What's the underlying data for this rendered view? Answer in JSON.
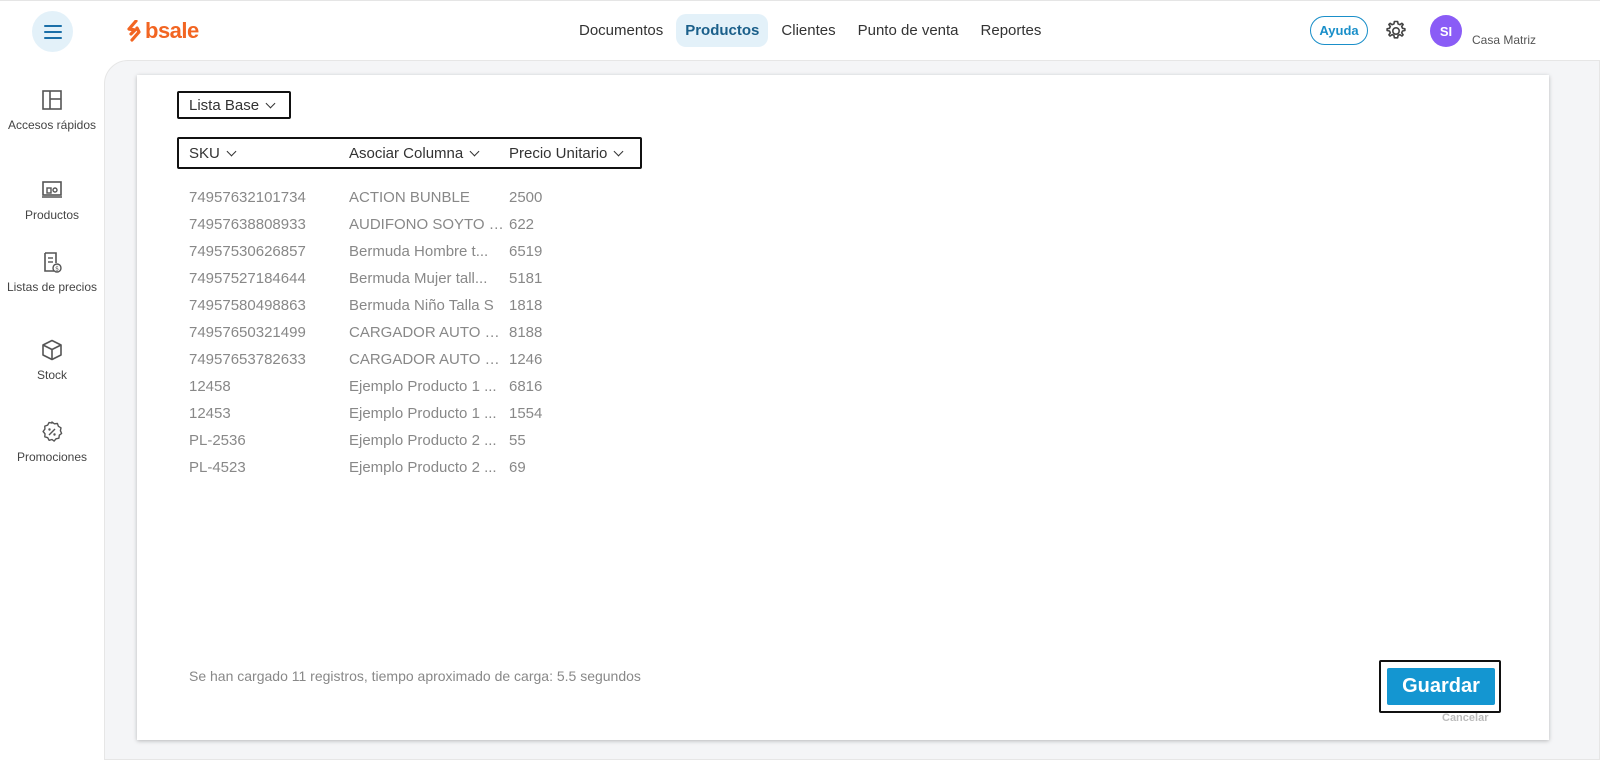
{
  "logo": {
    "text": "bsale"
  },
  "nav": {
    "items": [
      {
        "label": "Documentos",
        "active": false
      },
      {
        "label": "Productos",
        "active": true
      },
      {
        "label": "Clientes",
        "active": false
      },
      {
        "label": "Punto de venta",
        "active": false
      },
      {
        "label": "Reportes",
        "active": false
      }
    ]
  },
  "header": {
    "help_label": "Ayuda",
    "avatar_initials": "SI",
    "branch": "Casa Matriz"
  },
  "sidebar": {
    "items": [
      {
        "label": "Accesos rápidos",
        "icon": "layout-icon"
      },
      {
        "label": "Productos",
        "icon": "products-icon"
      },
      {
        "label": "Listas de precios",
        "icon": "price-list-icon"
      },
      {
        "label": "Stock",
        "icon": "box-icon"
      },
      {
        "label": "Promociones",
        "icon": "promo-icon"
      }
    ]
  },
  "main": {
    "list_select": "Lista Base",
    "columns": [
      "SKU",
      "Asociar Columna",
      "Precio Unitario"
    ],
    "rows": [
      {
        "sku": "74957632101734",
        "name": "ACTION BUNBLE",
        "price": "2500"
      },
      {
        "sku": "74957638808933",
        "name": "AUDIFONO SOYTO G...",
        "price": "622"
      },
      {
        "sku": "74957530626857",
        "name": "Bermuda Hombre t...",
        "price": "6519"
      },
      {
        "sku": "74957527184644",
        "name": "Bermuda Mujer tall...",
        "price": "5181"
      },
      {
        "sku": "74957580498863",
        "name": "Bermuda Niño Talla S",
        "price": "1818"
      },
      {
        "sku": "74957650321499",
        "name": "CARGADOR AUTO C...",
        "price": "8188"
      },
      {
        "sku": "74957653782633",
        "name": "CARGADOR AUTO M...",
        "price": "1246"
      },
      {
        "sku": "12458",
        "name": "Ejemplo Producto 1 ...",
        "price": "6816"
      },
      {
        "sku": "12453",
        "name": "Ejemplo Producto 1 ...",
        "price": "1554"
      },
      {
        "sku": "PL-2536",
        "name": "Ejemplo Producto 2 ...",
        "price": "55"
      },
      {
        "sku": "PL-4523",
        "name": "Ejemplo Producto 2 ...",
        "price": "69"
      }
    ],
    "status": "Se han cargado 11 registros, tiempo aproximado de carga: 5.5 segundos",
    "save_label": "Guardar",
    "cancel_label": "Cancelar"
  },
  "colors": {
    "brand": "#f26522",
    "accent": "#1496d1",
    "avatar": "#8a5cf6"
  }
}
